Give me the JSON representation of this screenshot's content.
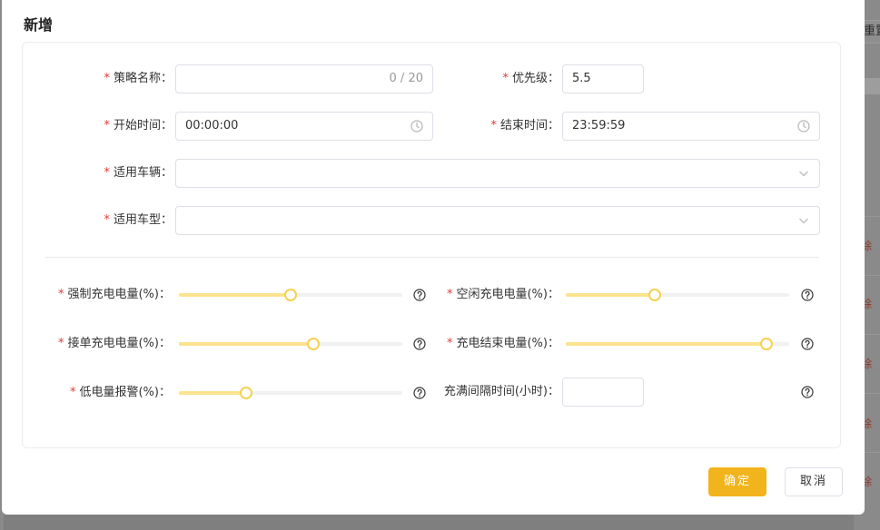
{
  "dialog": {
    "title": "新增"
  },
  "background": {
    "reset_label": "重置",
    "delete_label": "除"
  },
  "form": {
    "strategy_name": {
      "label": "策略名称",
      "value": "",
      "counter": "0 / 20"
    },
    "priority": {
      "label": "优先级",
      "value": "5.5"
    },
    "start_time": {
      "label": "开始时间",
      "value": "00:00:00"
    },
    "end_time": {
      "label": "结束时间",
      "value": "23:59:59"
    },
    "vehicles": {
      "label": "适用车辆",
      "value": ""
    },
    "vehicle_types": {
      "label": "适用车型",
      "value": ""
    },
    "forced_charge": {
      "label": "强制充电电量(%)",
      "level": 0.5
    },
    "idle_charge": {
      "label": "空闲充电电量(%)",
      "level": 0.4
    },
    "order_charge": {
      "label": "接单充电电量(%)",
      "level": 0.6
    },
    "charge_end": {
      "label": "充电结束电量(%)",
      "level": 0.9
    },
    "low_battery_alarm": {
      "label": "低电量报警(%)",
      "level": 0.3
    },
    "full_interval": {
      "label": "充满间隔时间(小时)",
      "value": ""
    },
    "colon": "："
  },
  "footer": {
    "confirm_label": "确定",
    "cancel_label": "取消"
  },
  "colors": {
    "accent": "#f2b41c",
    "slider_fill": "#fbe38f",
    "required": "#e53935"
  },
  "icons": {
    "time": "clock-icon",
    "dropdown": "chevron-down-icon",
    "help": "question-circle-icon"
  }
}
